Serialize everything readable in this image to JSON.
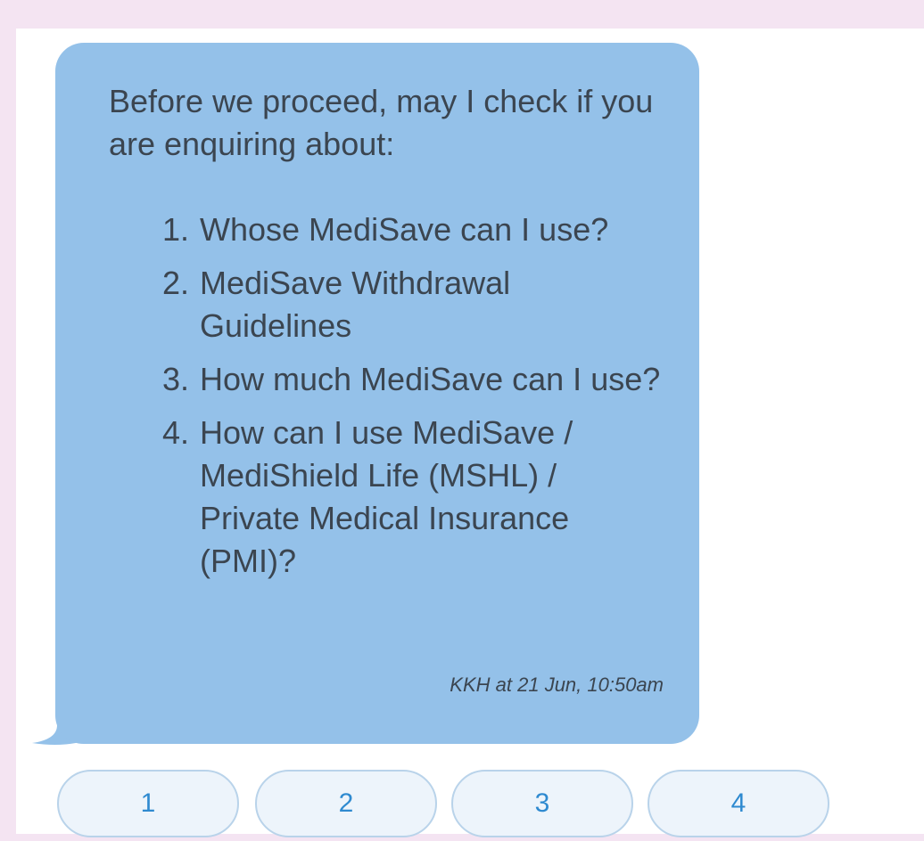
{
  "message": {
    "intro": "Before we proceed, may I check if you are enquiring about:",
    "options": [
      {
        "number": "1.",
        "text": "Whose MediSave can I use?"
      },
      {
        "number": "2.",
        "text": "MediSave Withdrawal Guidelines"
      },
      {
        "number": "3.",
        "text": "How much MediSave can I use?"
      },
      {
        "number": "4.",
        "text": "How can I use MediSave / MediShield Life (MSHL) / Private Medical Insurance (PMI)?"
      }
    ],
    "timestamp": "KKH at 21 Jun, 10:50am"
  },
  "quick_replies": [
    "1",
    "2",
    "3",
    "4"
  ],
  "colors": {
    "page_background": "#f4e4f2",
    "bubble": "#94c1e9",
    "reply_text": "#2f8ad0"
  }
}
